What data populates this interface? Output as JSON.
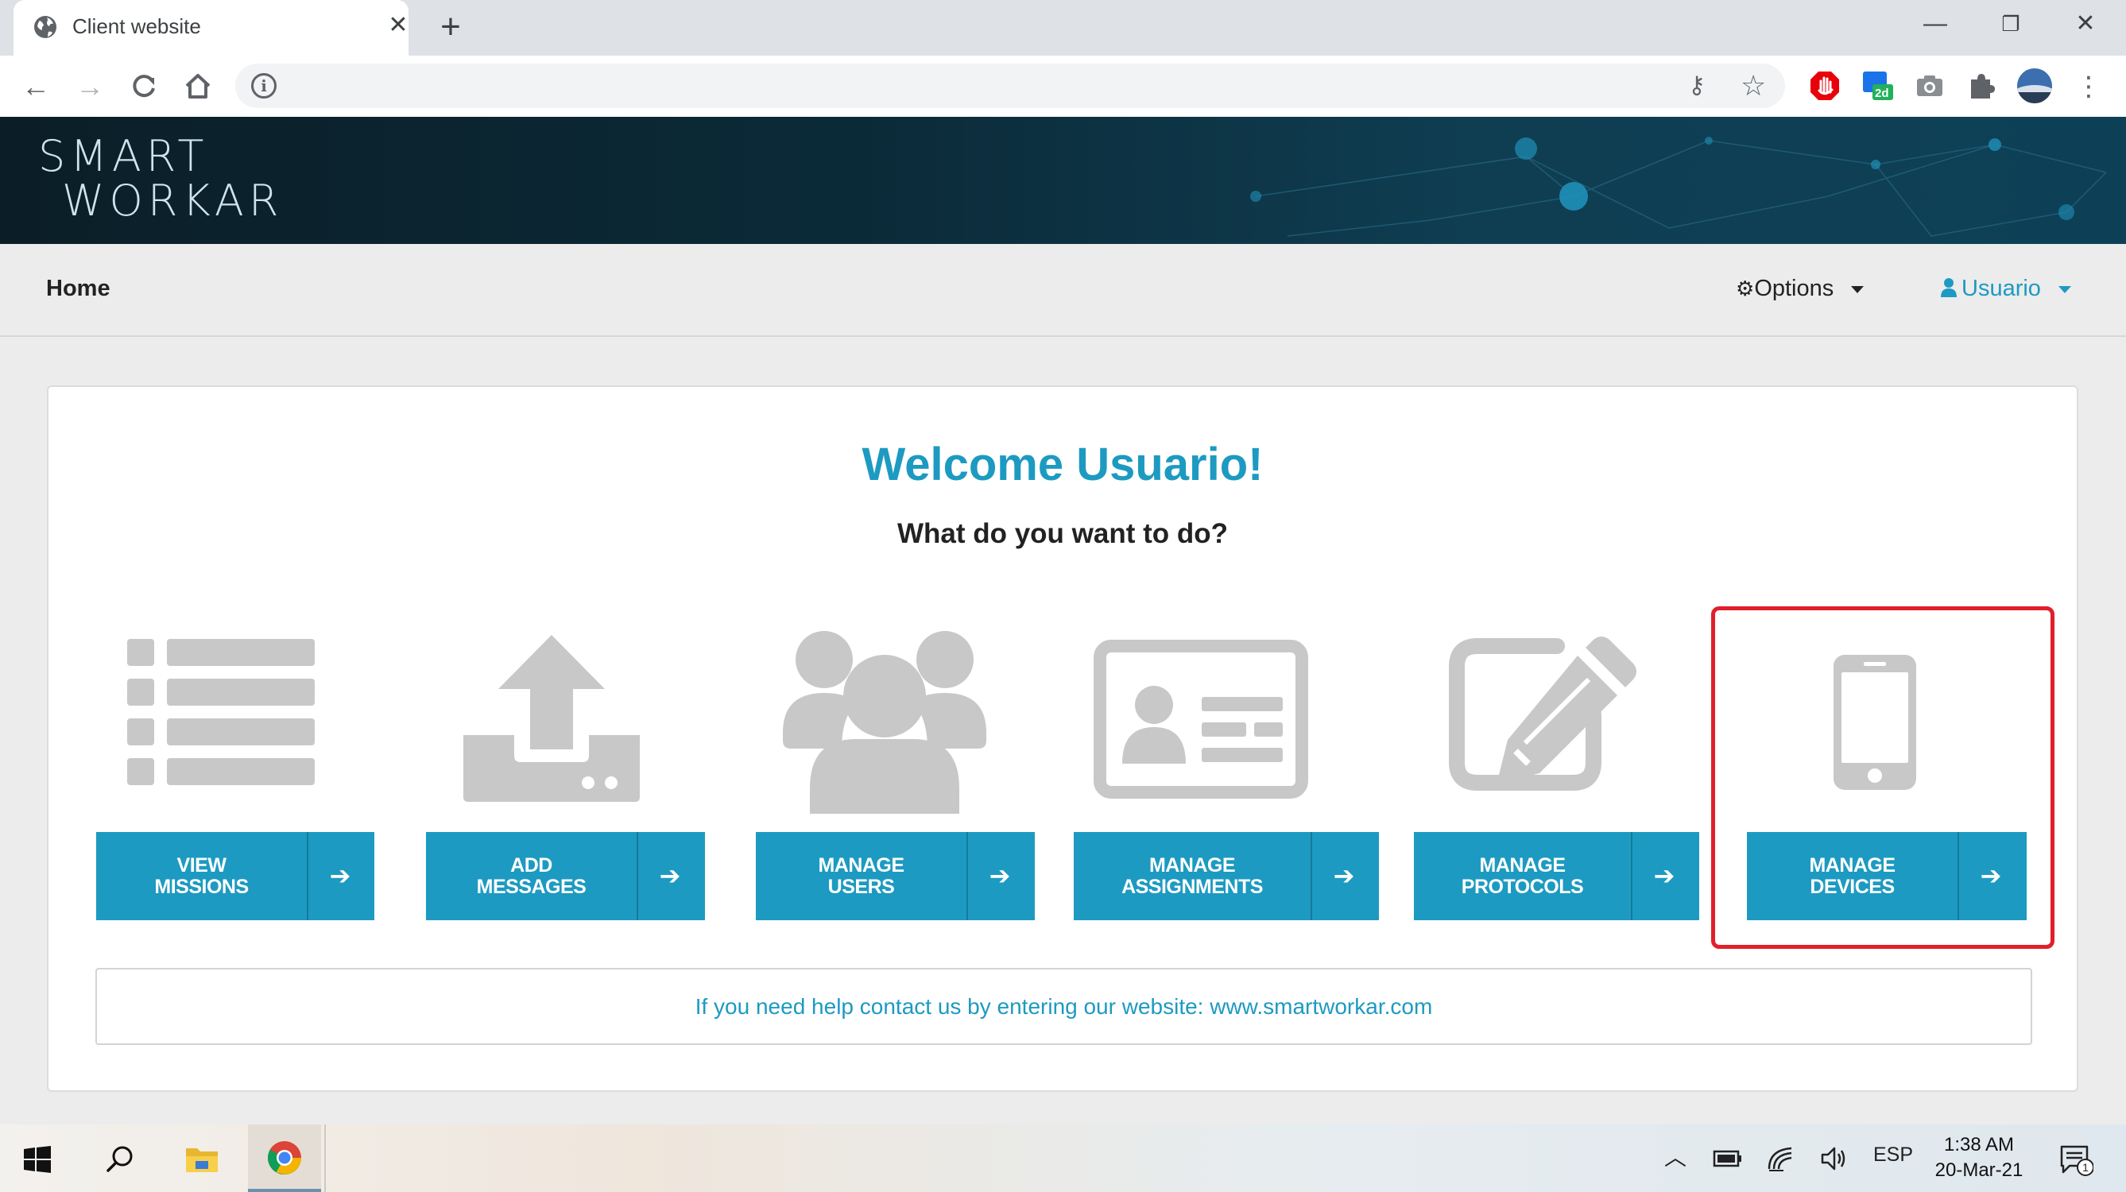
{
  "browser": {
    "tab_title": "Client website",
    "window_controls": {
      "minimize": "—",
      "restore": "❐",
      "close": "✕"
    }
  },
  "site": {
    "logo": {
      "line1": "SMART",
      "line2": "WORKAR"
    },
    "nav": {
      "home": "Home",
      "options": "Options",
      "user": "Usuario"
    }
  },
  "main": {
    "welcome": "Welcome Usuario!",
    "question": "What do you want to do?",
    "actions": [
      {
        "line1": "VIEW",
        "line2": "MISSIONS",
        "icon": "list-icon"
      },
      {
        "line1": "ADD",
        "line2": "MESSAGES",
        "icon": "upload-icon"
      },
      {
        "line1": "MANAGE",
        "line2": "USERS",
        "icon": "users-icon"
      },
      {
        "line1": "MANAGE",
        "line2": "ASSIGNMENTS",
        "icon": "id-card-icon"
      },
      {
        "line1": "MANAGE",
        "line2": "PROTOCOLS",
        "icon": "edit-icon"
      },
      {
        "line1": "MANAGE",
        "line2": "DEVICES",
        "icon": "mobile-phone-icon"
      }
    ],
    "help_text": "If you need help contact us by entering our website: www.smartworkar.com"
  },
  "taskbar": {
    "language": "ESP",
    "time": "1:38 AM",
    "date": "20-Mar-21",
    "notification_count": "1"
  },
  "colors": {
    "accent": "#1d9ac1",
    "icon_gray": "#c8c8c8",
    "highlight": "#e0202a"
  }
}
